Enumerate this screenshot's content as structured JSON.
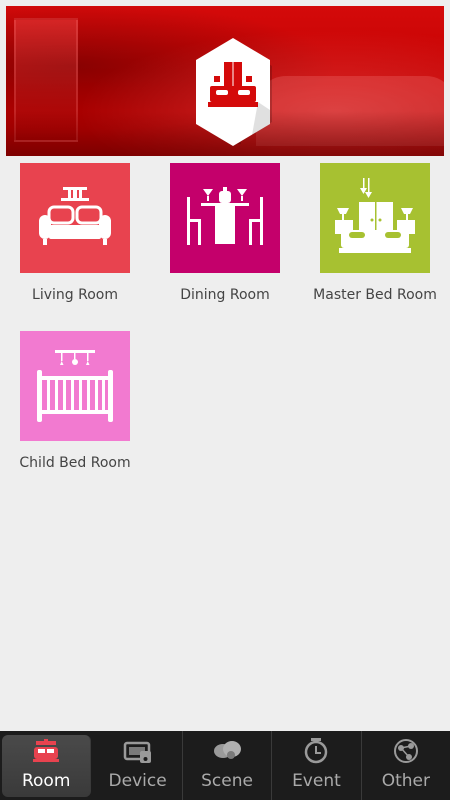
{
  "header": {
    "banner_icon": "bedroom-hexagon-icon",
    "accent": "#d40a0a"
  },
  "rooms": [
    {
      "label": "Living Room",
      "icon": "sofa-icon",
      "color": "#e8434f"
    },
    {
      "label": "Dining Room",
      "icon": "dining-table-icon",
      "color": "#c4006b"
    },
    {
      "label": "Master Bed Room",
      "icon": "bed-icon",
      "color": "#a7c131"
    },
    {
      "label": "Child Bed Room",
      "icon": "crib-icon",
      "color": "#f27ad0"
    }
  ],
  "nav": [
    {
      "label": "Room",
      "icon": "room-icon",
      "active": true
    },
    {
      "label": "Device",
      "icon": "device-icon",
      "active": false
    },
    {
      "label": "Scene",
      "icon": "scene-icon",
      "active": false
    },
    {
      "label": "Event",
      "icon": "alarm-clock-icon",
      "active": false
    },
    {
      "label": "Other",
      "icon": "share-icon",
      "active": false
    }
  ]
}
